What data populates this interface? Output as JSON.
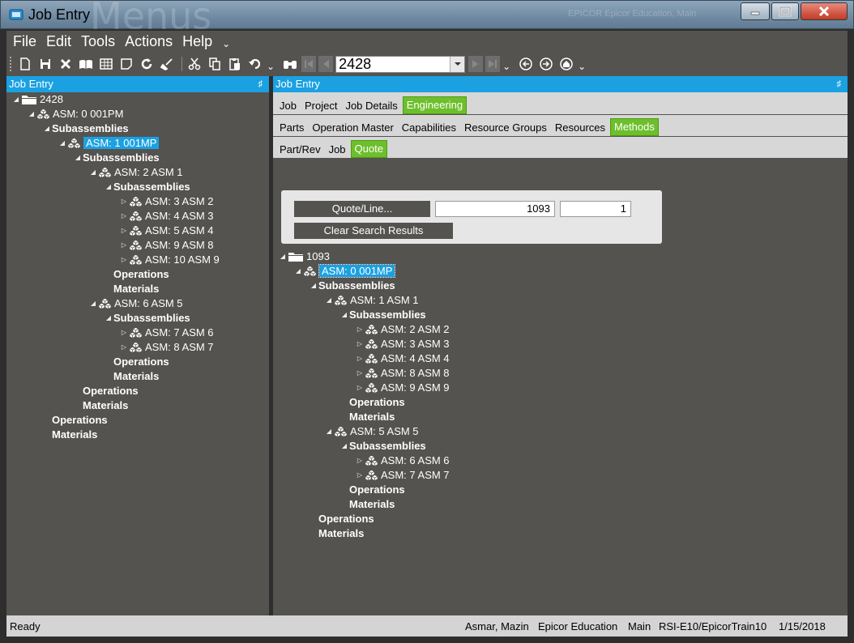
{
  "window": {
    "title": "Job Entry",
    "watermark": "Menus",
    "brand_text": "EPICOR Epicor Education, Main"
  },
  "menu": [
    "File",
    "Edit",
    "Tools",
    "Actions",
    "Help"
  ],
  "toolbar": {
    "job_number": "2428",
    "icons": [
      "new-icon",
      "save-icon",
      "delete-icon",
      "open-book-icon",
      "grid-icon",
      "note-icon",
      "refresh-icon",
      "clear-icon",
      "cut-icon",
      "copy-icon",
      "paste-icon",
      "undo-icon",
      "binoculars-icon",
      "first-icon",
      "prev-icon",
      "next-icon",
      "last-icon",
      "back-icon",
      "forward-icon",
      "home-icon"
    ]
  },
  "left_panel": {
    "title": "Job Entry",
    "tree": [
      {
        "label": "2428",
        "level": 0,
        "type": "folder",
        "exp": "open"
      },
      {
        "label": "ASM: 0 001PM",
        "level": 1,
        "type": "asm",
        "exp": "open"
      },
      {
        "label": "Subassemblies",
        "level": 2,
        "type": "group",
        "exp": "open"
      },
      {
        "label": "ASM: 1 001MP",
        "level": 3,
        "type": "asm",
        "exp": "open",
        "selected": true
      },
      {
        "label": "Subassemblies",
        "level": 4,
        "type": "group",
        "exp": "open"
      },
      {
        "label": "ASM: 2 ASM 1",
        "level": 5,
        "type": "asm",
        "exp": "open"
      },
      {
        "label": "Subassemblies",
        "level": 6,
        "type": "group",
        "exp": "open"
      },
      {
        "label": "ASM: 3 ASM 2",
        "level": 7,
        "type": "asm",
        "exp": "closed"
      },
      {
        "label": "ASM: 4 ASM 3",
        "level": 7,
        "type": "asm",
        "exp": "closed"
      },
      {
        "label": "ASM: 5 ASM 4",
        "level": 7,
        "type": "asm",
        "exp": "closed"
      },
      {
        "label": "ASM: 9 ASM 8",
        "level": 7,
        "type": "asm",
        "exp": "closed"
      },
      {
        "label": "ASM: 10 ASM 9",
        "level": 7,
        "type": "asm",
        "exp": "closed"
      },
      {
        "label": "Operations",
        "level": 6,
        "type": "leaf"
      },
      {
        "label": "Materials",
        "level": 6,
        "type": "leaf"
      },
      {
        "label": "ASM: 6 ASM 5",
        "level": 5,
        "type": "asm",
        "exp": "open"
      },
      {
        "label": "Subassemblies",
        "level": 6,
        "type": "group",
        "exp": "open"
      },
      {
        "label": "ASM: 7 ASM 6",
        "level": 7,
        "type": "asm",
        "exp": "closed"
      },
      {
        "label": "ASM: 8 ASM 7",
        "level": 7,
        "type": "asm",
        "exp": "closed"
      },
      {
        "label": "Operations",
        "level": 6,
        "type": "leaf"
      },
      {
        "label": "Materials",
        "level": 6,
        "type": "leaf"
      },
      {
        "label": "Operations",
        "level": 4,
        "type": "leaf"
      },
      {
        "label": "Materials",
        "level": 4,
        "type": "leaf"
      },
      {
        "label": "Operations",
        "level": 2,
        "type": "leaf"
      },
      {
        "label": "Materials",
        "level": 2,
        "type": "leaf"
      }
    ]
  },
  "right_panel": {
    "title": "Job Entry",
    "tabs_row1": [
      "Job",
      "Project",
      "Job Details",
      "Engineering"
    ],
    "tabs_row1_active": "Engineering",
    "tabs_row2": [
      "Parts",
      "Operation Master",
      "Capabilities",
      "Resource Groups",
      "Resources",
      "Methods"
    ],
    "tabs_row2_active": "Methods",
    "tabs_row3": [
      "Part/Rev",
      "Job",
      "Quote"
    ],
    "tabs_row3_active": "Quote",
    "quote_line_button": "Quote/Line...",
    "quote_number": "1093",
    "line_number": "1",
    "clear_button": "Clear Search Results",
    "tree": [
      {
        "label": "1093",
        "level": 0,
        "type": "folder",
        "exp": "open"
      },
      {
        "label": "ASM: 0 001MP",
        "level": 1,
        "type": "asm",
        "exp": "open",
        "selected": true
      },
      {
        "label": "Subassemblies",
        "level": 2,
        "type": "group",
        "exp": "open"
      },
      {
        "label": "ASM: 1 ASM 1",
        "level": 3,
        "type": "asm",
        "exp": "open"
      },
      {
        "label": "Subassemblies",
        "level": 4,
        "type": "group",
        "exp": "open"
      },
      {
        "label": "ASM: 2 ASM 2",
        "level": 5,
        "type": "asm",
        "exp": "closed"
      },
      {
        "label": "ASM: 3 ASM 3",
        "level": 5,
        "type": "asm",
        "exp": "closed"
      },
      {
        "label": "ASM: 4 ASM 4",
        "level": 5,
        "type": "asm",
        "exp": "closed"
      },
      {
        "label": "ASM: 8 ASM 8",
        "level": 5,
        "type": "asm",
        "exp": "closed"
      },
      {
        "label": "ASM: 9 ASM 9",
        "level": 5,
        "type": "asm",
        "exp": "closed"
      },
      {
        "label": "Operations",
        "level": 4,
        "type": "leaf"
      },
      {
        "label": "Materials",
        "level": 4,
        "type": "leaf"
      },
      {
        "label": "ASM: 5 ASM 5",
        "level": 3,
        "type": "asm",
        "exp": "open"
      },
      {
        "label": "Subassemblies",
        "level": 4,
        "type": "group",
        "exp": "open"
      },
      {
        "label": "ASM: 6 ASM 6",
        "level": 5,
        "type": "asm",
        "exp": "closed"
      },
      {
        "label": "ASM: 7 ASM 7",
        "level": 5,
        "type": "asm",
        "exp": "closed"
      },
      {
        "label": "Operations",
        "level": 4,
        "type": "leaf"
      },
      {
        "label": "Materials",
        "level": 4,
        "type": "leaf"
      },
      {
        "label": "Operations",
        "level": 2,
        "type": "leaf"
      },
      {
        "label": "Materials",
        "level": 2,
        "type": "leaf"
      }
    ]
  },
  "status": {
    "state": "Ready",
    "user": "Asmar, Mazin",
    "company": "Epicor Education",
    "site": "Main",
    "environment": "RSI-E10/EpicorTrain10",
    "date": "1/15/2018"
  },
  "colors": {
    "header_blue": "#1ba1e2",
    "tab_active_green": "#6dbf2c",
    "panel_bg": "#55534f"
  }
}
